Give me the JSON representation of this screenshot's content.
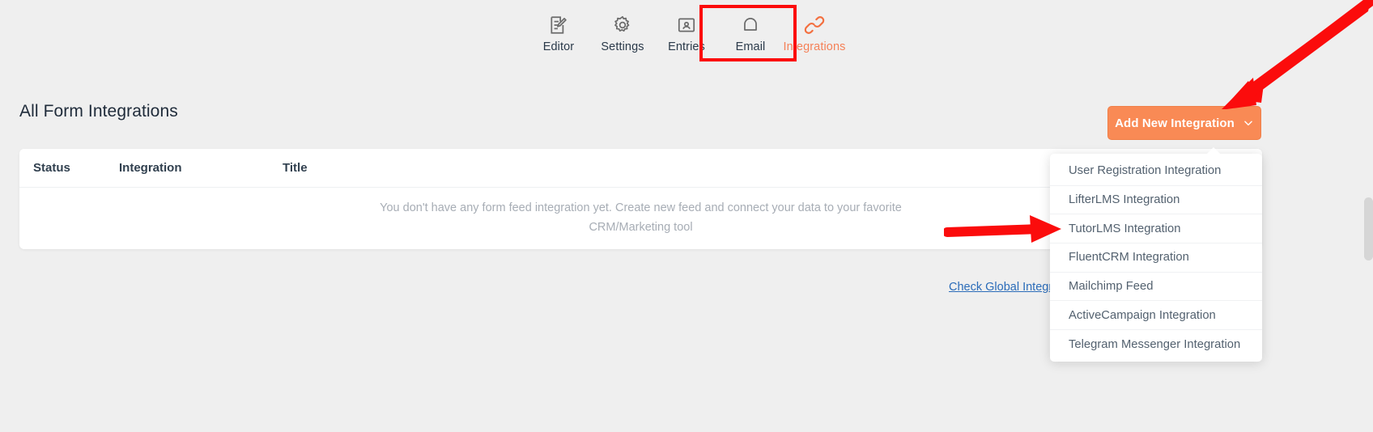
{
  "nav": {
    "items": [
      {
        "label": "Editor",
        "icon": "editor-icon",
        "active": false
      },
      {
        "label": "Settings",
        "icon": "gear-icon",
        "active": false
      },
      {
        "label": "Entries",
        "icon": "entries-icon",
        "active": false
      },
      {
        "label": "Email",
        "icon": "bell-icon",
        "active": false
      },
      {
        "label": "Integrations",
        "icon": "link-chain-icon",
        "active": true
      }
    ],
    "active_highlight_color": "#fc0b0b"
  },
  "header": {
    "title": "All Form Integrations",
    "add_button_label": "Add New Integration",
    "add_button_icon": "chevron-down-icon",
    "accent_color": "#f98a55"
  },
  "table": {
    "columns": [
      "Status",
      "Integration",
      "Title"
    ],
    "rows": [],
    "empty_message": "You don't have any form feed integration yet. Create new feed and connect your data to your favorite CRM/Marketing tool"
  },
  "links": {
    "global_integration": "Check Global Integrations"
  },
  "dropdown": {
    "visible": true,
    "items": [
      "User Registration Integration",
      "LifterLMS Integration",
      "TutorLMS Integration",
      "FluentCRM Integration",
      "Mailchimp Feed",
      "ActiveCampaign Integration",
      "Telegram Messenger Integration"
    ]
  },
  "annotations": {
    "arrow_color": "#fb0c0c",
    "arrow_to_add_button": "arrow-pointing-to-add-new-integration-button",
    "arrow_to_tutorlms": "arrow-pointing-to-tutorlms-integration"
  }
}
